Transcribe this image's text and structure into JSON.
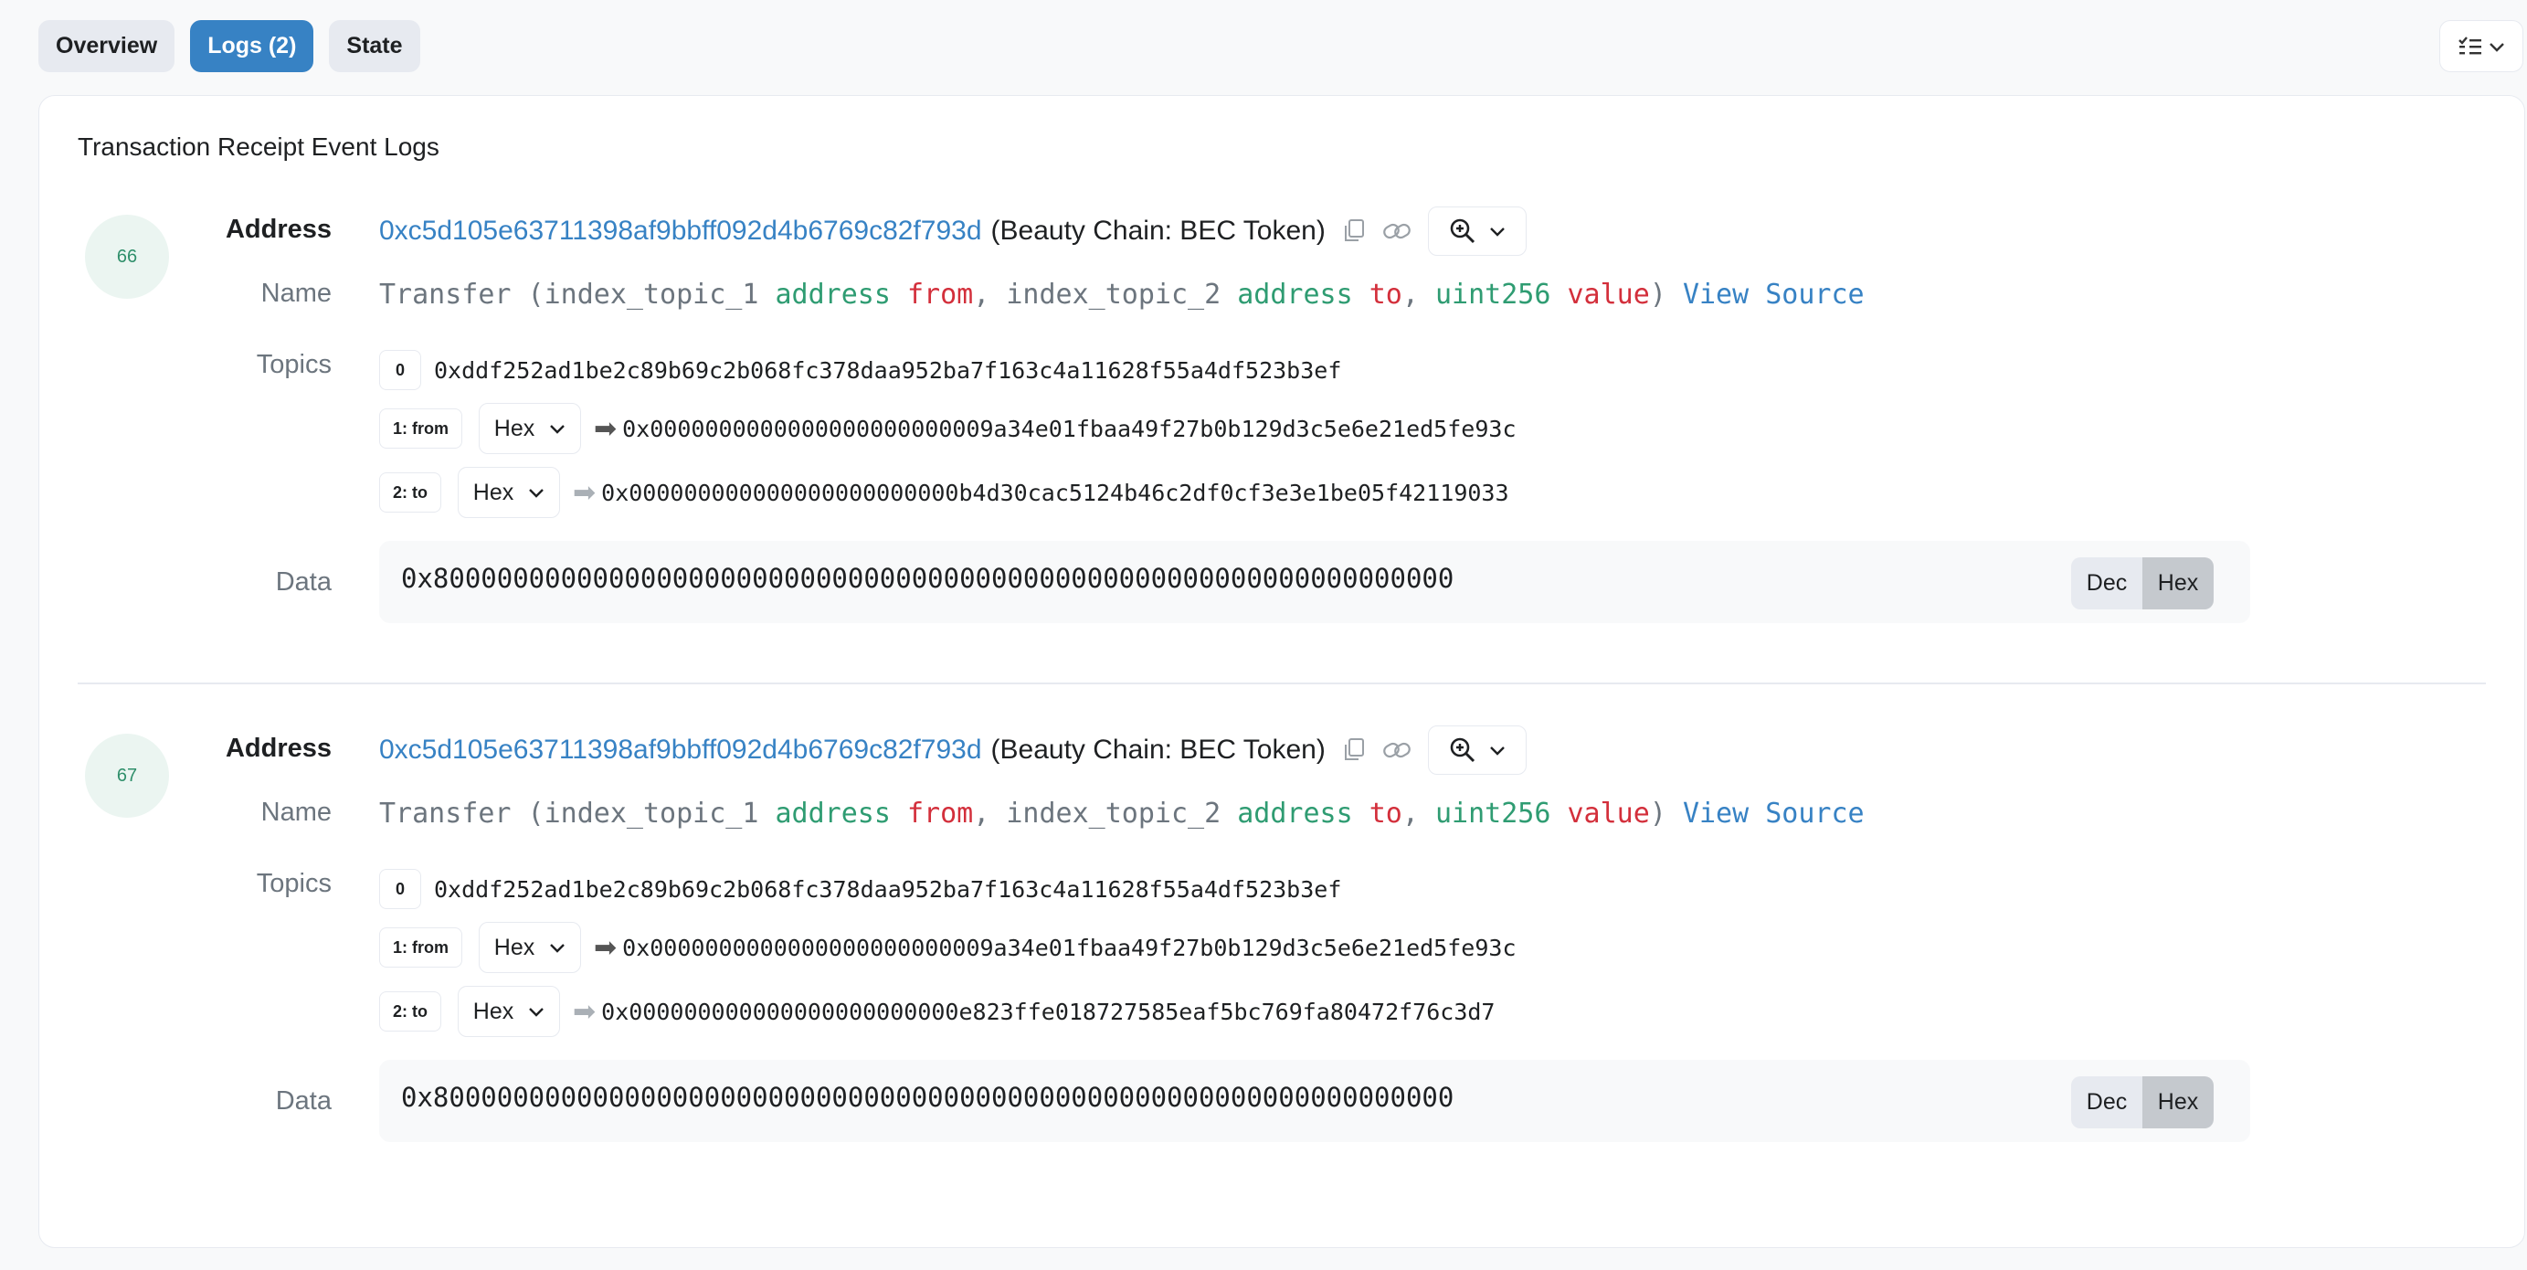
{
  "tabs": [
    {
      "label": "Overview",
      "active": false
    },
    {
      "label": "Logs (2)",
      "active": true
    },
    {
      "label": "State",
      "active": false
    }
  ],
  "card_title": "Transaction Receipt Event Logs",
  "labels": {
    "address": "Address",
    "name": "Name",
    "topics": "Topics",
    "data": "Data"
  },
  "name_parts": {
    "func": "Transfer (",
    "p1_index": "index_topic_1 ",
    "p1_type": "address",
    "p1_name": "from",
    "sep": ", ",
    "p2_index": "index_topic_2 ",
    "p2_type": "address",
    "p2_name": "to",
    "p3_type": "uint256",
    "p3_name": "value",
    "close": ")",
    "view_source": "View Source"
  },
  "logs": [
    {
      "index": "66",
      "address": "0xc5d105e63711398af9bbff092d4b6769c82f793d",
      "address_tag": "(Beauty Chain: BEC Token)",
      "topics": [
        {
          "badge": "0",
          "value": "0xddf252ad1be2c89b69c2b068fc378daa952ba7f163c4a11628f55a4df523b3ef"
        },
        {
          "badge": "1: from",
          "format": "Hex",
          "value": "0x0000000000000000000000009a34e01fbaa49f27b0b129d3c5e6e21ed5fe93c"
        },
        {
          "badge": "2: to",
          "format": "Hex",
          "value": "0x000000000000000000000000b4d30cac5124b46c2df0cf3e3e1be05f42119033"
        }
      ],
      "data": "0x8000000000000000000000000000000000000000000000000000000000000000",
      "dec_label": "Dec",
      "hex_label": "Hex"
    },
    {
      "index": "67",
      "address": "0xc5d105e63711398af9bbff092d4b6769c82f793d",
      "address_tag": "(Beauty Chain: BEC Token)",
      "topics": [
        {
          "badge": "0",
          "value": "0xddf252ad1be2c89b69c2b068fc378daa952ba7f163c4a11628f55a4df523b3ef"
        },
        {
          "badge": "1: from",
          "format": "Hex",
          "value": "0x0000000000000000000000009a34e01fbaa49f27b0b129d3c5e6e21ed5fe93c"
        },
        {
          "badge": "2: to",
          "format": "Hex",
          "value": "0x000000000000000000000000e823ffe018727585eaf5bc769fa80472f76c3d7"
        }
      ],
      "data": "0x8000000000000000000000000000000000000000000000000000000000000000",
      "dec_label": "Dec",
      "hex_label": "Hex"
    }
  ]
}
